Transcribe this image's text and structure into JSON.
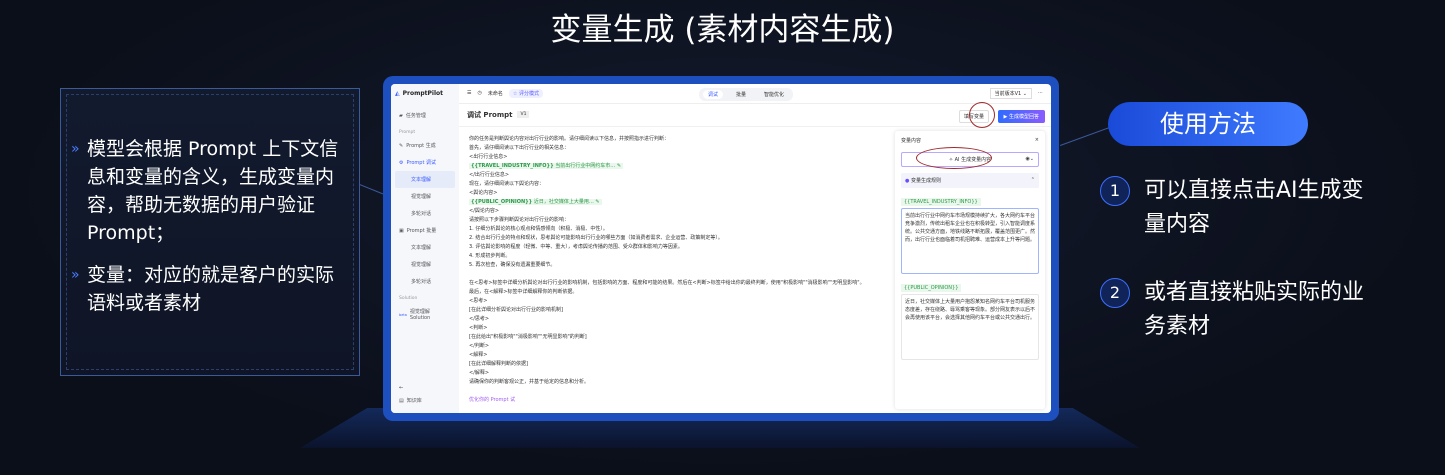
{
  "slide": {
    "title": "变量生成 (素材内容生成)",
    "left_points": [
      "模型会根据 Prompt 上下文信息和变量的含义，生成变量内容，帮助无数据的用户验证 Prompt；",
      "变量：对应的就是客户的实际语料或者素材"
    ],
    "usage_title": "使用方法",
    "steps": [
      {
        "num": "1",
        "text": "可以直接点击AI生成变量内容"
      },
      {
        "num": "2",
        "text": "或者直接粘贴实际的业务素材"
      }
    ]
  },
  "app": {
    "brand": "PromptPilot",
    "sidebar": {
      "task": "任务管理",
      "section_prompt": "Prompt",
      "items": [
        "Prompt 生成",
        "Prompt 调试",
        "文本理解",
        "视觉理解",
        "多轮对话",
        "Prompt 批量",
        "文本理解",
        "视觉理解",
        "多轮对话"
      ],
      "section_solution": "Solution",
      "beta": "beta",
      "solution_item": "视觉理解 Solution",
      "knowledge": "知识库"
    },
    "topbar": {
      "name": "未命名",
      "mode": "评分模式",
      "tabs": [
        "调试",
        "批量",
        "智能优化"
      ],
      "version": "当前版本V1"
    },
    "header": {
      "title": "调试 Prompt",
      "version": "V1",
      "fill_vars": "填写变量",
      "generate": "生成模型回答"
    },
    "prompt": {
      "l1": "你的任务是判断舆论内容对出行行业的影响。请仔细阅读以下信息，并按照指示进行判断：\n首先，请仔细阅读以下出行行业的相关信息：\n<出行行业信息>",
      "v1": "{{TRAVEL_INDUSTRY_INFO}}",
      "v1p": " 当前出行行业中网约车市…",
      "l2": "</出行行业信息>\n现在，请仔细阅读以下舆论内容：\n<舆论内容>",
      "v2": "{{PUBLIC_OPINION}}",
      "v2p": " 近日，社交媒体上大量用…",
      "l3": "</舆论内容>\n请按照以下步骤判断舆论对出行行业的影响：\n1. 仔细分析舆论的核心观点和情感倾向（积极、消极、中性）。\n2. 结合出行行业的特点和现状，思考舆论可能影响出行行业的哪些方面（如消费者需求、企业运营、政策制定等）。\n3. 评估舆论影响的程度（轻微、中等、重大），考虑舆论传播的范围、受众群体和影响力等因素。\n4. 形成初步判断。\n5. 再次检查，确保没有遗漏重要细节。\n\n在<思考>标签中详细分析舆论对出行行业的影响机制，包括影响的方面、程度和可能的结果。然后在<判断>标签中给出你的最终判断，使用\"积极影响\"\"消极影响\"\"无明显影响\"。\n最后，在<解释>标签中详细解释你的判断依据。\n<思考>\n[在此详细分析舆论对出行行业的影响机制]\n</思考>\n<判断>\n[在此给出\"积极影响\"\"消极影响\"\"无明显影响\"的判断]\n</判断>\n<解释>\n[在此详细解释判断的依据]\n</解释>\n请确保你的判断客观公正，并基于给定的信息和分析。",
      "optimize": "优化你的 Prompt 试"
    },
    "panel": {
      "title": "变量内容",
      "ai_button": "AI 生成变量内容",
      "rules": "变量生成规则",
      "var1": "{{TRAVEL_INDUSTRY_INFO}}",
      "val1": "当前出行行业中网约车市场规模持续扩大，各大网约车平台竞争激烈，传统出租车企业也在积极转型，引入智能调度系统。公共交通方面，地铁线路不断拓展，覆盖范围更广。然而，出行行业也面临着司机招聘难、运营成本上升等问题。",
      "var2": "{{PUBLIC_OPINION}}",
      "val2": "近日，社交媒体上大量用户抱怨某知名网约车平台司机服务态度差，存在绕路、辱骂乘客等现象。部分网友表示以后不会再使用该平台，会选择其他网约车平台或公共交通出行。"
    }
  },
  "colors": {
    "accent": "#3a5bff",
    "highlight_ring": "#a0282a",
    "variable_green": "#2b9a48"
  }
}
